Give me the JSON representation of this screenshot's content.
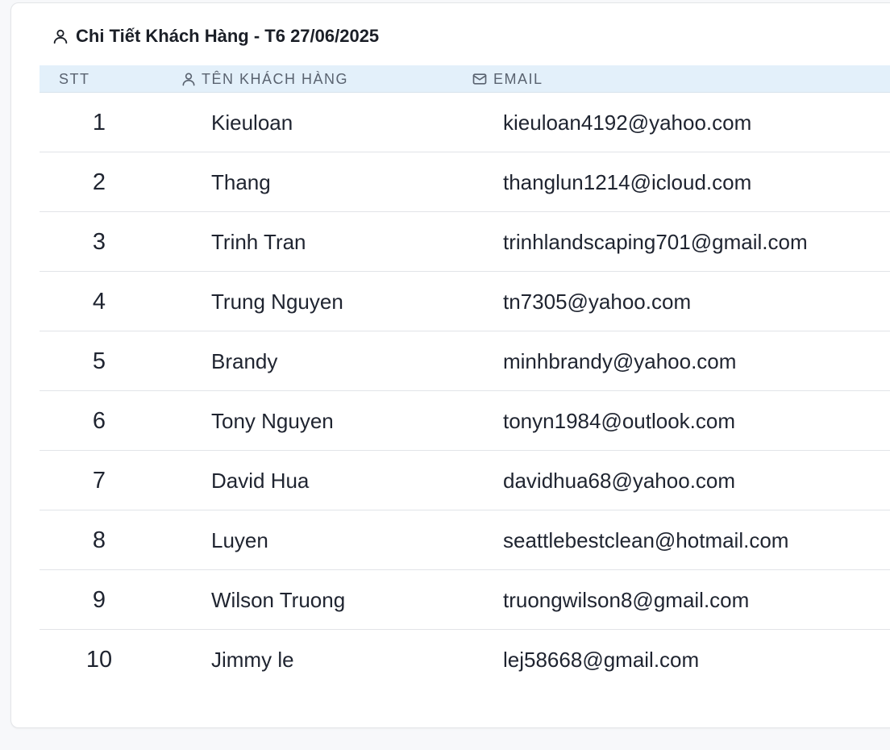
{
  "panel": {
    "title": "Chi Tiết Khách Hàng - T6 27/06/2025"
  },
  "table": {
    "columns": {
      "stt": "STT",
      "name": "TÊN KHÁCH HÀNG",
      "email": "EMAIL"
    },
    "rows": [
      {
        "stt": "1",
        "name": "Kieuloan",
        "email": "kieuloan4192@yahoo.com"
      },
      {
        "stt": "2",
        "name": "Thang",
        "email": "thanglun1214@icloud.com"
      },
      {
        "stt": "3",
        "name": "Trinh Tran",
        "email": "trinhlandscaping701@gmail.com"
      },
      {
        "stt": "4",
        "name": "Trung Nguyen",
        "email": "tn7305@yahoo.com"
      },
      {
        "stt": "5",
        "name": "Brandy",
        "email": "minhbrandy@yahoo.com"
      },
      {
        "stt": "6",
        "name": "Tony Nguyen",
        "email": "tonyn1984@outlook.com"
      },
      {
        "stt": "7",
        "name": "David Hua",
        "email": "davidhua68@yahoo.com"
      },
      {
        "stt": "8",
        "name": "Luyen",
        "email": "seattlebestclean@hotmail.com"
      },
      {
        "stt": "9",
        "name": "Wilson Truong",
        "email": "truongwilson8@gmail.com"
      },
      {
        "stt": "10",
        "name": "Jimmy le",
        "email": "lej58668@gmail.com"
      }
    ]
  },
  "icons": {
    "title": "user-icon",
    "name_column": "user-icon",
    "email_column": "mail-icon"
  },
  "colors": {
    "header_bg": "#e3f0fa",
    "header_text": "#5a6370",
    "row_divider": "#e2e4e8"
  }
}
